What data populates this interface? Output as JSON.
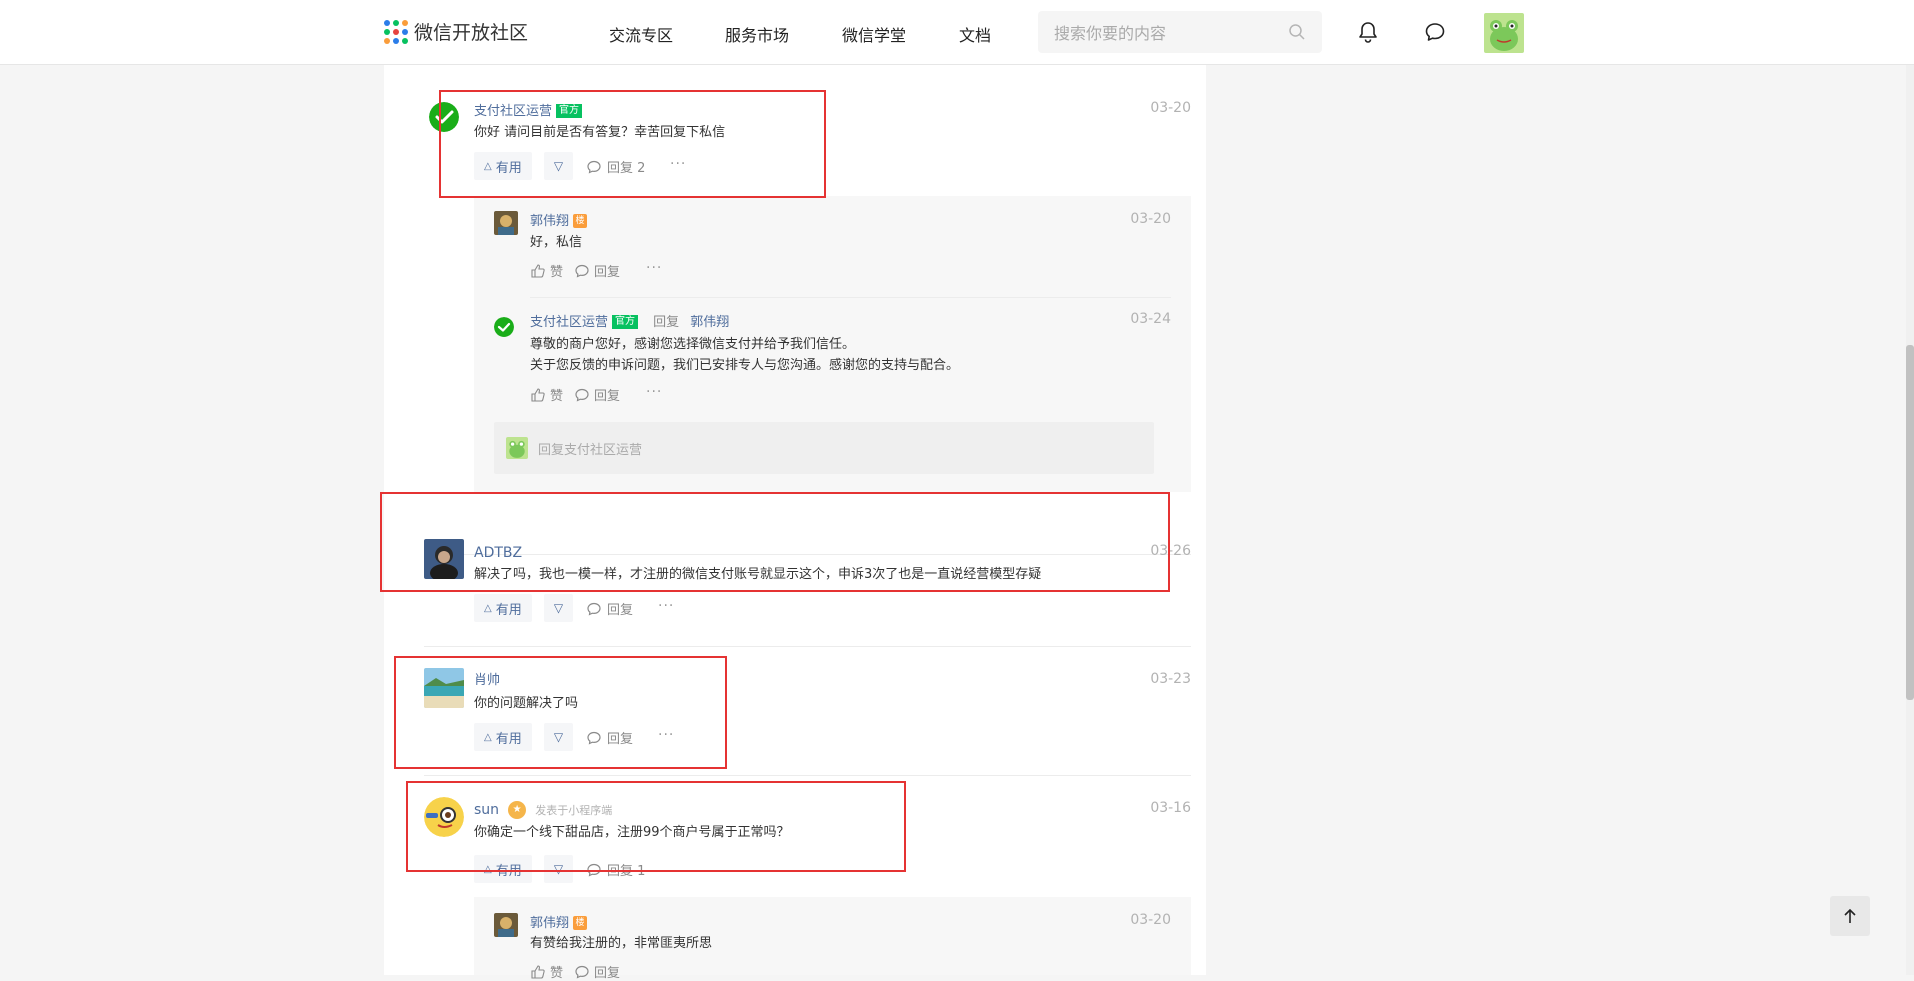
{
  "header": {
    "logo_text": "微信开放社区",
    "nav": [
      "交流专区",
      "服务市场",
      "微信学堂",
      "文档"
    ],
    "search_placeholder": "搜索你要的内容"
  },
  "labels": {
    "official": "官方",
    "useful": "有用",
    "reply": "回复",
    "like": "赞",
    "more": "···"
  },
  "comments": [
    {
      "name": "支付社区运营",
      "official": true,
      "date": "03-20",
      "text": "你好 请问目前是否有答复？幸苦回复下私信",
      "reply_label": "回复 2",
      "replies": [
        {
          "name": "郭伟翔",
          "badge": "楼",
          "date": "03-20",
          "text": "好，私信"
        },
        {
          "name": "支付社区运营",
          "official": true,
          "reply_word": "回复",
          "reply_to": "郭伟翔",
          "date": "03-24",
          "text_line1": "尊敬的商户您好，感谢您选择微信支付并给予我们信任。",
          "text_line2": "关于您反馈的申诉问题，我们已安排专人与您沟通。感谢您的支持与配合。"
        }
      ],
      "reply_input_placeholder": "回复支付社区运营"
    },
    {
      "name": "ADTBZ",
      "date": "03-26",
      "text": "解决了吗，我也一模一样，才注册的微信支付账号就显示这个，申诉3次了也是一直说经营模型存疑",
      "reply_label": "回复"
    },
    {
      "name": "肖帅",
      "date": "03-23",
      "text": "你的问题解决了吗",
      "reply_label": "回复"
    },
    {
      "name": "sun",
      "source": "发表于小程序端",
      "date": "03-16",
      "text": "你确定一个线下甜品店，注册99个商户号属于正常吗？",
      "reply_label": "回复 1",
      "replies": [
        {
          "name": "郭伟翔",
          "badge": "楼",
          "date": "03-20",
          "text": "有赞给我注册的，非常匪夷所思"
        }
      ]
    }
  ],
  "colors": {
    "link": "#4f6d9c",
    "official_badge": "#07c160",
    "author_badge": "#fa9d3b",
    "highlight_box": "#e53333"
  }
}
